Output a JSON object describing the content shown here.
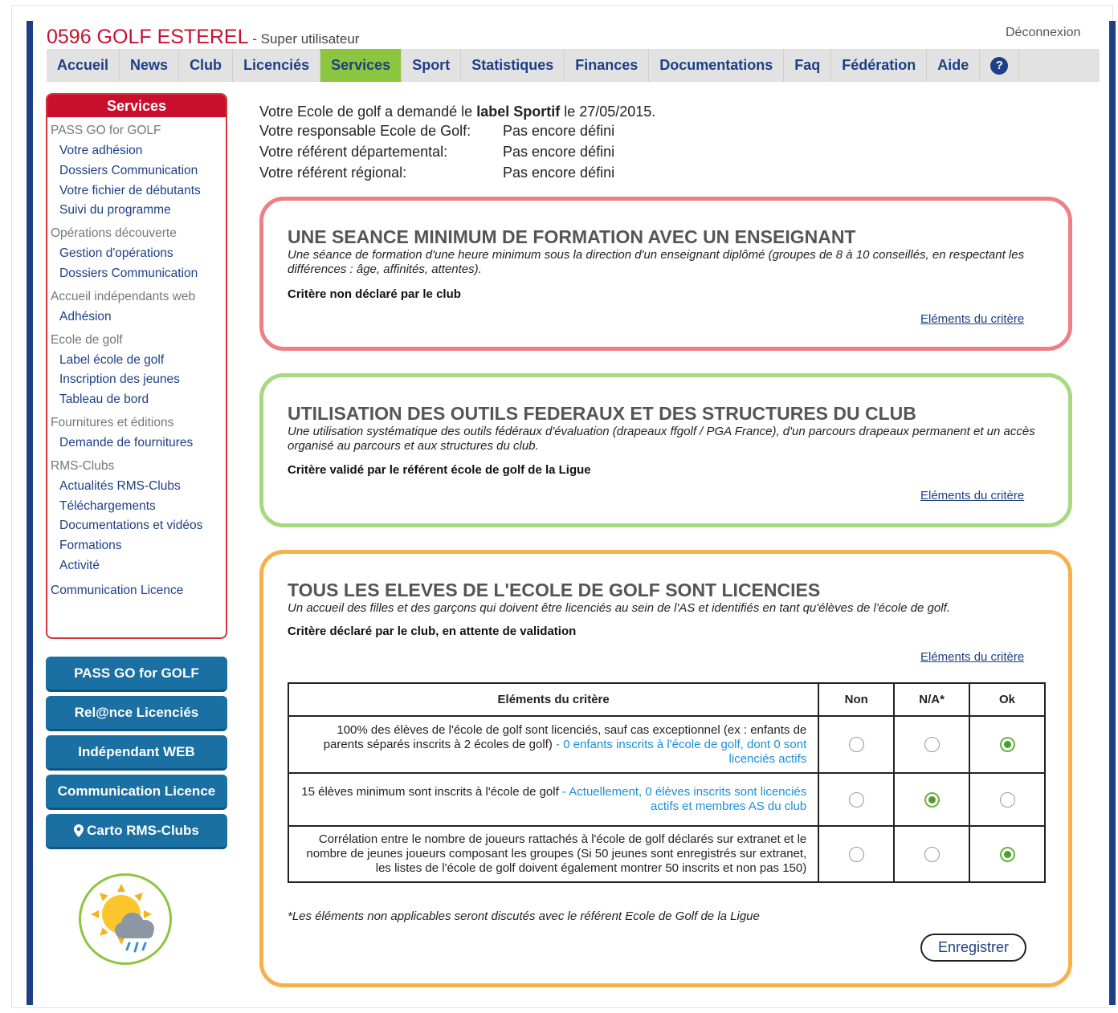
{
  "header": {
    "club_name": "0596 GOLF ESTEREL",
    "role": " - Super utilisateur",
    "logout": "Déconnexion"
  },
  "nav": {
    "items": [
      "Accueil",
      "News",
      "Club",
      "Licenciés",
      "Services",
      "Sport",
      "Statistiques",
      "Finances",
      "Documentations",
      "Faq",
      "Fédération",
      "Aide"
    ],
    "active": "Services",
    "help_icon": "?"
  },
  "sidebar": {
    "title": "Services",
    "g1": "PASS GO for GOLF",
    "l1": "Votre adhésion",
    "l2": "Dossiers Communication",
    "l3": "Votre fichier de débutants",
    "l4": "Suivi du programme",
    "g2": "Opérations découverte",
    "l5": "Gestion d'opérations",
    "l6": "Dossiers Communication",
    "g3": "Accueil indépendants web",
    "l7": "Adhésion",
    "g4": "Ecole de golf",
    "l8": "Label école de golf",
    "l9": "Inscription des jeunes",
    "l10": "Tableau de bord",
    "g5": "Fournitures et éditions",
    "l11": "Demande de fournitures",
    "g6": "RMS-Clubs",
    "l12": "Actualités RMS-Clubs",
    "l13": "Téléchargements",
    "l14": "Documentations et vidéos",
    "l15": "Formations",
    "l16": "Activité",
    "g7": "Communication Licence"
  },
  "side_buttons": {
    "b1": "PASS GO for GOLF",
    "b2": "Rel@nce Licenciés",
    "b3": "Indépendant WEB",
    "b4": "Communication Licence",
    "b5": "Carto RMS-Clubs",
    "b5_icon": "map-pin-icon"
  },
  "info": {
    "line1_pre": "Votre Ecole de golf a demandé le ",
    "line1_bold": "label Sportif",
    "line1_post": " le 27/05/2015.",
    "resp_label": "Votre responsable Ecole de Golf:",
    "resp_value": "Pas encore défini",
    "dep_label": "Votre référent départemental:",
    "dep_value": "Pas encore défini",
    "reg_label": "Votre référent régional:",
    "reg_value": "Pas encore défini"
  },
  "cards": {
    "c1": {
      "title": "UNE SEANCE MINIMUM DE FORMATION AVEC UN ENSEIGNANT",
      "desc": "Une séance de formation d'une heure minimum sous la direction d'un enseignant diplômé (groupes de 8 à 10 conseillés, en respectant les différences : âge, affinités, attentes).",
      "status": "Critère non déclaré par le club",
      "link": "Eléments du critère"
    },
    "c2": {
      "title": "UTILISATION DES OUTILS FEDERAUX ET DES STRUCTURES DU CLUB",
      "desc": "Une utilisation systématique des outils fédéraux d'évaluation (drapeaux ffgolf / PGA France), d'un parcours drapeaux permanent et un accès organisé au parcours et aux structures du club.",
      "status": "Critère validé par le référent école de golf de la Ligue",
      "link": "Eléments du critère"
    },
    "c3": {
      "title": "TOUS LES ELEVES DE L'ECOLE DE GOLF SONT LICENCIES",
      "desc": "Un accueil des filles et des garçons qui doivent être licenciés au sein de l'AS et identifiés en tant qu'élèves de l'école de golf.",
      "status": "Critère déclaré par le club, en attente de validation",
      "link": "Eléments du critère",
      "table": {
        "headers": [
          "Eléments du critère",
          "Non",
          "N/A*",
          "Ok"
        ],
        "rows": [
          {
            "text": "100% des élèves de l'école de golf sont licenciés, sauf cas exceptionnel (ex : enfants de parents séparés inscrits à 2 écoles de golf)",
            "note": " - 0 enfants inscrits à l'école de golf, dont 0 sont licenciés actifs",
            "choice": "Ok"
          },
          {
            "text": "15 élèves minimum sont inscrits à l'école de golf",
            "note": " - Actuellement, 0 élèves inscrits sont licenciés actifs et membres AS du club",
            "choice": "N/A*"
          },
          {
            "text": "Corrélation entre le nombre de joueurs rattachés à l'école de golf déclarés sur extranet et le nombre de jeunes joueurs composant les groupes (Si 50 jeunes sont enregistrés sur extranet, les listes de l'école de golf doivent également montrer 50 inscrits et non pas 150)",
            "note": "",
            "choice": "Ok"
          }
        ]
      },
      "footnote": "*Les éléments non applicables seront discutés avec le référent Ecole de Golf de la Ligue",
      "save": "Enregistrer"
    }
  }
}
